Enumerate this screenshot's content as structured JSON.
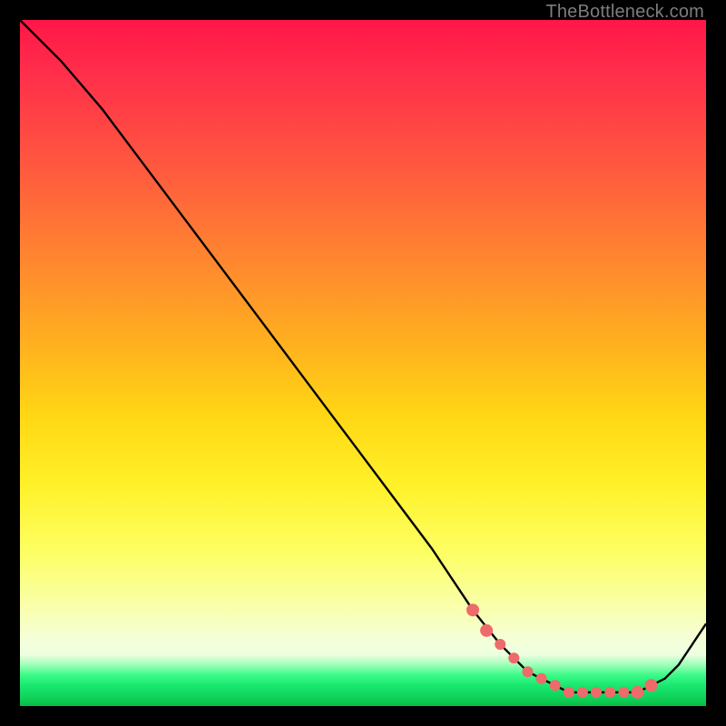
{
  "attribution": "TheBottleneck.com",
  "colors": {
    "frame": "#000000",
    "curve": "#000000",
    "marker": "#ef6a6a",
    "gradient_top": "#ff1648",
    "gradient_bottom": "#06bd42"
  },
  "chart_data": {
    "type": "line",
    "title": "",
    "xlabel": "",
    "ylabel": "",
    "xlim": [
      0,
      100
    ],
    "ylim": [
      0,
      100
    ],
    "series": [
      {
        "name": "bottleneck-curve",
        "x": [
          0,
          6,
          12,
          18,
          24,
          30,
          36,
          42,
          48,
          54,
          60,
          66,
          70,
          74,
          78,
          80,
          82,
          84,
          86,
          88,
          90,
          92,
          94,
          96,
          98,
          100
        ],
        "y": [
          100,
          94,
          87,
          79,
          71,
          63,
          55,
          47,
          39,
          31,
          23,
          14,
          9,
          5,
          3,
          2,
          2,
          2,
          2,
          2,
          2,
          3,
          4,
          6,
          9,
          12
        ]
      }
    ],
    "markers": {
      "name": "highlighted-points",
      "x": [
        66,
        68,
        70,
        72,
        74,
        76,
        78,
        80,
        82,
        84,
        86,
        88,
        90,
        92
      ],
      "y": [
        14,
        11,
        9,
        7,
        5,
        4,
        3,
        2,
        2,
        2,
        2,
        2,
        2,
        3
      ]
    }
  }
}
